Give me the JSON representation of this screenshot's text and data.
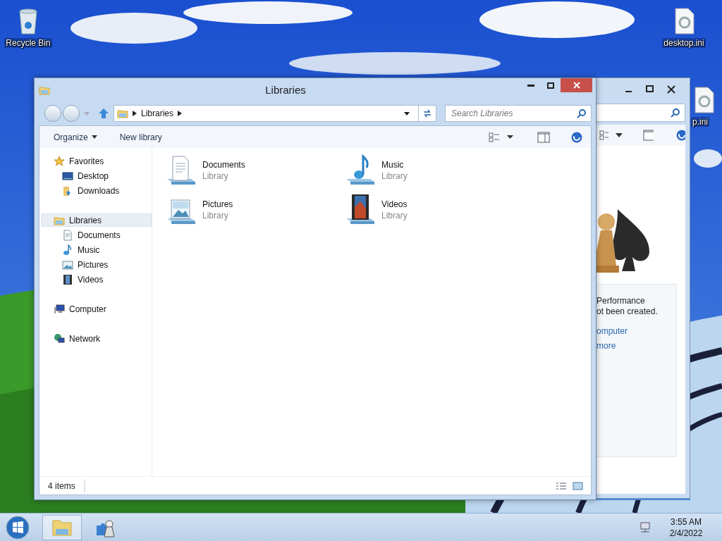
{
  "desktop": {
    "icons": [
      {
        "label": "Recycle Bin",
        "kind": "recycle"
      },
      {
        "label": "desktop.ini",
        "kind": "file"
      },
      {
        "label": "p.ini",
        "kind": "file"
      }
    ]
  },
  "back_window": {
    "texts": [
      "Performance",
      "ot been created."
    ],
    "links": [
      "omputer",
      "more"
    ]
  },
  "window": {
    "title": "Libraries",
    "address": [
      "Libraries"
    ],
    "search": {
      "placeholder": "Search Libraries"
    },
    "toolbar": [
      {
        "label": "Organize",
        "kind": "menu"
      },
      {
        "label": "New library",
        "kind": "button"
      }
    ],
    "navigation": [
      {
        "label": "Favorites",
        "kind": "star",
        "selected": false,
        "children": [
          {
            "label": "Desktop",
            "kind": "desktop",
            "selected": false
          },
          {
            "label": "Downloads",
            "kind": "downloads",
            "selected": false
          }
        ]
      },
      {
        "label": "Libraries",
        "kind": "library",
        "selected": true,
        "children": [
          {
            "label": "Documents",
            "kind": "documents",
            "selected": false
          },
          {
            "label": "Music",
            "kind": "music",
            "selected": false
          },
          {
            "label": "Pictures",
            "kind": "pictures",
            "selected": false
          },
          {
            "label": "Videos",
            "kind": "videos",
            "selected": false
          }
        ]
      },
      {
        "label": "Computer",
        "kind": "computer",
        "selected": false
      },
      {
        "label": "Network",
        "kind": "network",
        "selected": false
      }
    ],
    "items": [
      {
        "name": "Documents",
        "type": "Library",
        "kind": "documents"
      },
      {
        "name": "Music",
        "type": "Library",
        "kind": "music"
      },
      {
        "name": "Pictures",
        "type": "Library",
        "kind": "pictures"
      },
      {
        "name": "Videos",
        "type": "Library",
        "kind": "videos"
      }
    ],
    "status_bar": "4 items"
  },
  "taskbar": {
    "time": "3:55 AM",
    "date": "2/4/2022"
  }
}
